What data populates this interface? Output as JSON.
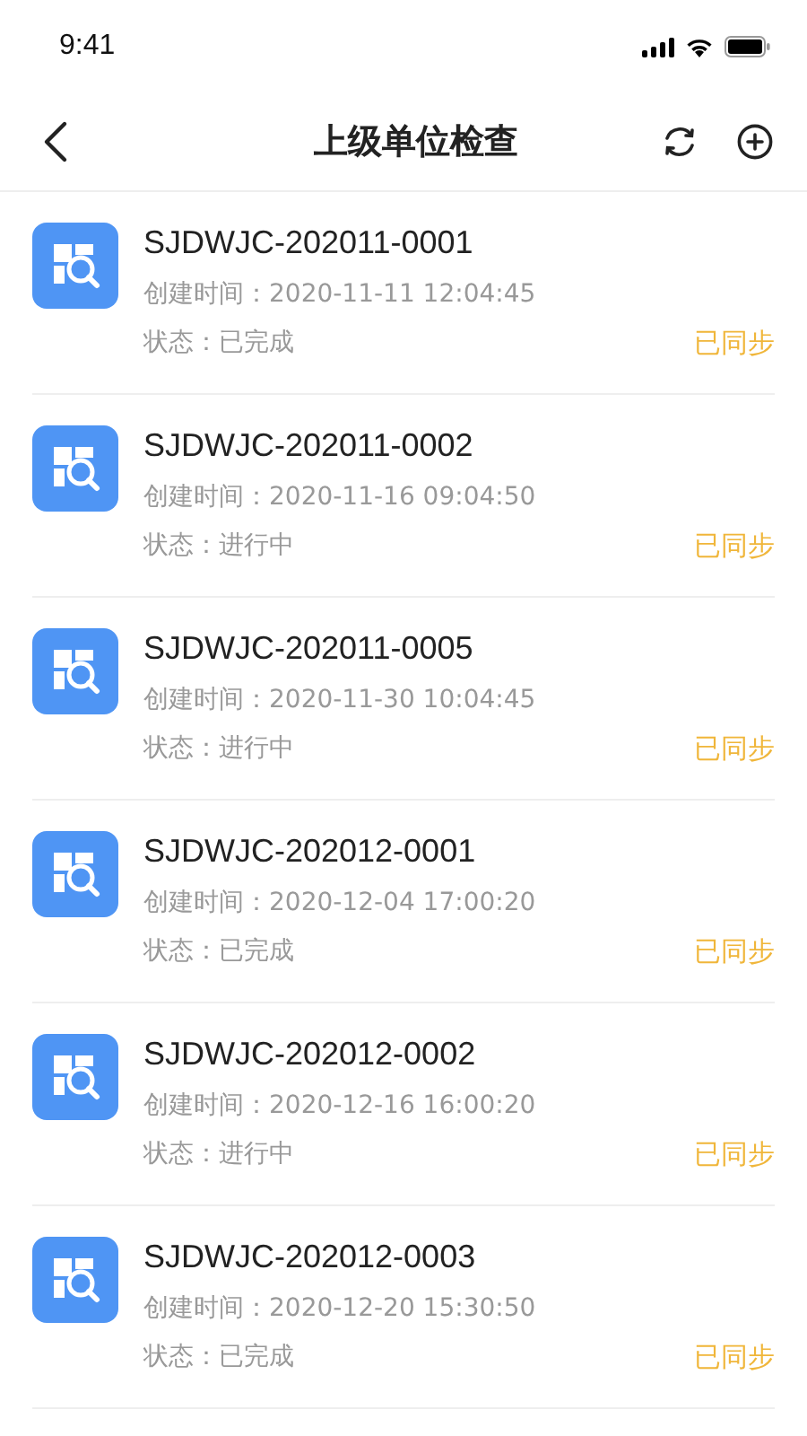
{
  "status_bar": {
    "time": "9:41"
  },
  "nav": {
    "title": "上级单位检查"
  },
  "records": [
    {
      "code": "SJDWJC-202011-0001",
      "created_label": "创建时间：",
      "created": "2020-11-11 12:04:45",
      "status_label": "状态：",
      "status": "已完成",
      "sync": "已同步"
    },
    {
      "code": "SJDWJC-202011-0002",
      "created_label": "创建时间：",
      "created": "2020-11-16 09:04:50",
      "status_label": "状态：",
      "status": "进行中",
      "sync": "已同步"
    },
    {
      "code": "SJDWJC-202011-0005",
      "created_label": "创建时间：",
      "created": "2020-11-30 10:04:45",
      "status_label": "状态：",
      "status": "进行中",
      "sync": "已同步"
    },
    {
      "code": "SJDWJC-202012-0001",
      "created_label": "创建时间：",
      "created": "2020-12-04 17:00:20",
      "status_label": "状态：",
      "status": "已完成",
      "sync": "已同步"
    },
    {
      "code": "SJDWJC-202012-0002",
      "created_label": "创建时间：",
      "created": "2020-12-16 16:00:20",
      "status_label": "状态：",
      "status": "进行中",
      "sync": "已同步"
    },
    {
      "code": "SJDWJC-202012-0003",
      "created_label": "创建时间：",
      "created": "2020-12-20 15:30:50",
      "status_label": "状态：",
      "status": "已完成",
      "sync": "已同步"
    }
  ]
}
